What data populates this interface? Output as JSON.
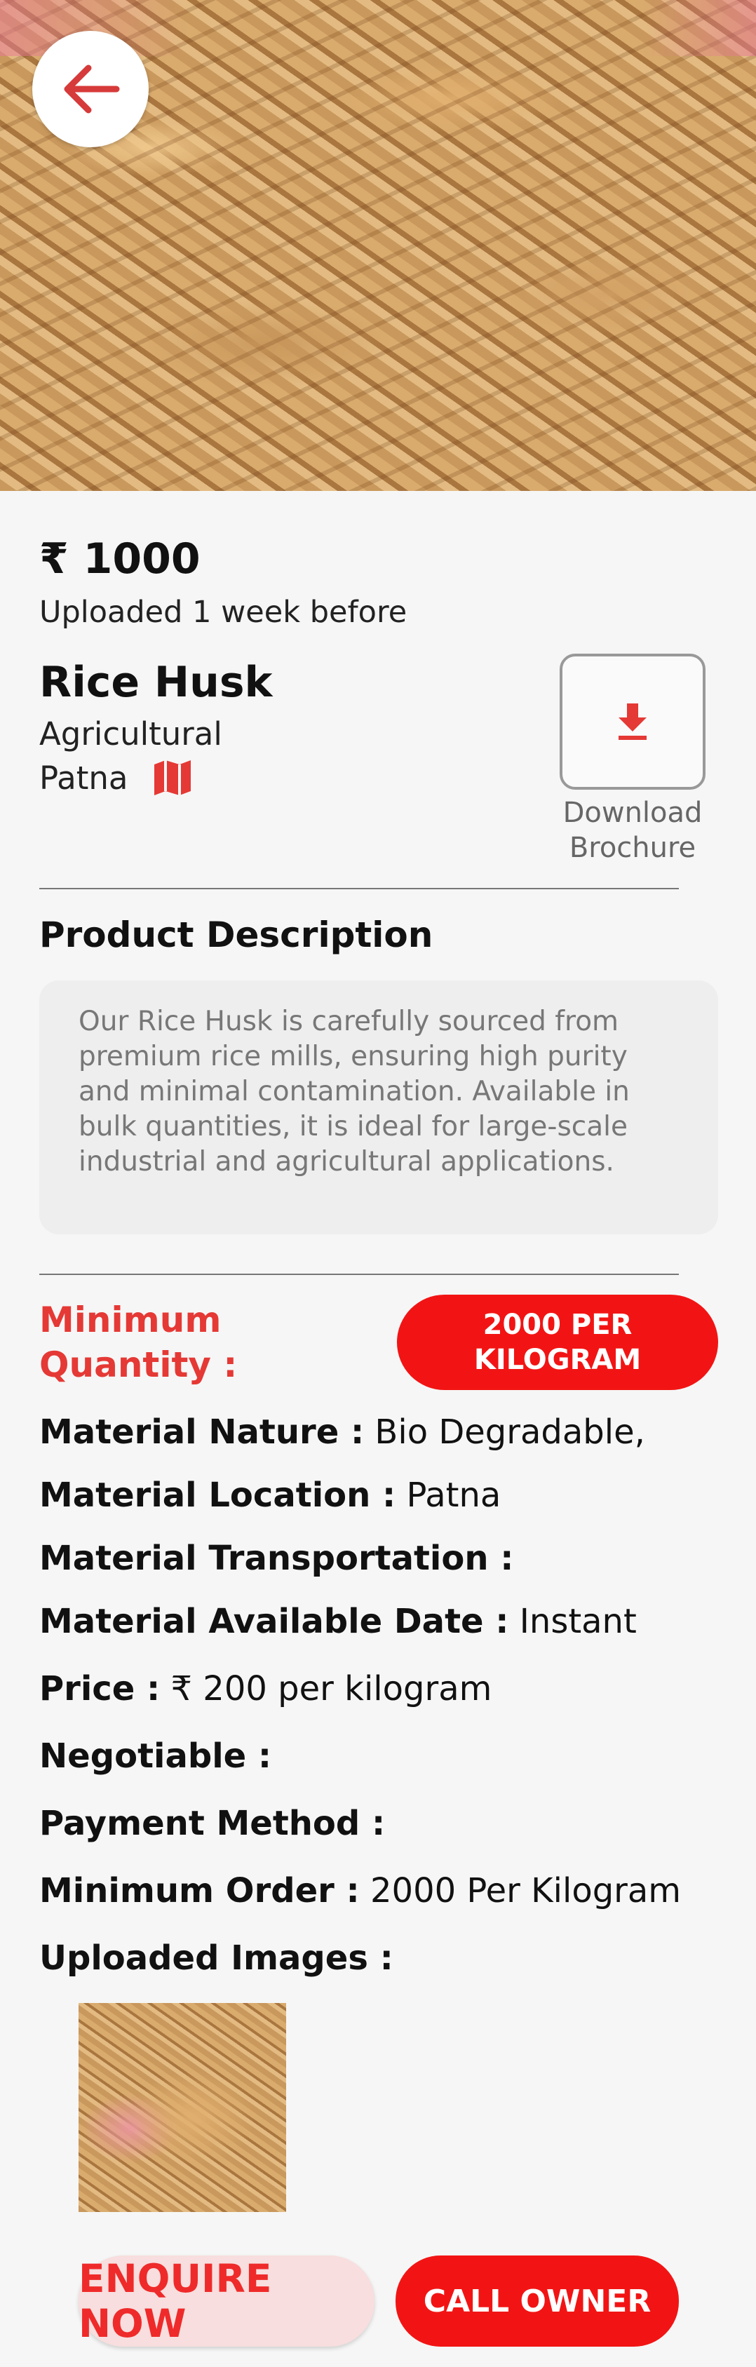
{
  "product": {
    "price": "₹ 1000",
    "uploaded": "Uploaded 1 week before",
    "title": "Rice Husk",
    "category": "Agricultural",
    "location": "Patna"
  },
  "brochure": {
    "label_line1": "Download",
    "label_line2": "Brochure"
  },
  "description": {
    "heading": "Product Description",
    "text": "Our Rice Husk is carefully sourced from premium rice mills, ensuring high purity and minimal contamination. Available in bulk quantities, it is ideal for large-scale industrial and agricultural applications."
  },
  "min_quantity": {
    "label_line1": "Minimum",
    "label_line2": "Quantity :",
    "badge_line1": "2000 PER",
    "badge_line2": "KILOGRAM"
  },
  "fields": [
    {
      "key": "Material Nature :",
      "value": "Bio Degradable,"
    },
    {
      "key": "Material Location :",
      "value": "Patna"
    },
    {
      "key": "Material Transportation :",
      "value": ""
    },
    {
      "key": "Material Available Date :",
      "value": "Instant"
    },
    {
      "key": "Price :",
      "value": "₹ 200 per kilogram"
    },
    {
      "key": "Negotiable :",
      "value": ""
    },
    {
      "key": "Payment Method :",
      "value": ""
    },
    {
      "key": "Minimum Order :",
      "value": "2000 Per Kilogram"
    },
    {
      "key": "Uploaded Images :",
      "value": ""
    }
  ],
  "actions": {
    "enquire": "ENQUIRE NOW",
    "call": "CALL OWNER"
  },
  "colors": {
    "accent": "#f21414",
    "accent_text": "#e53935",
    "enquire_bg": "#f8dede"
  },
  "icons": {
    "back": "arrow-left-icon",
    "map": "map-icon",
    "download": "download-icon"
  }
}
